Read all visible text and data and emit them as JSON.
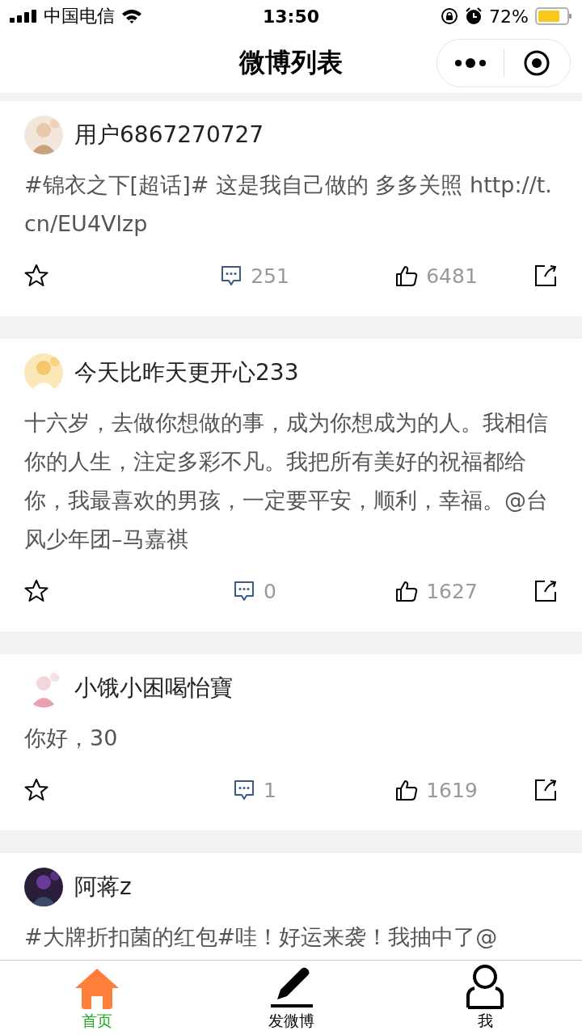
{
  "status_bar": {
    "carrier": "中国电信",
    "time": "13:50",
    "battery": "72%"
  },
  "nav": {
    "title": "微博列表"
  },
  "posts": [
    {
      "user": "用户6867270727",
      "text": "#锦衣之下[超话]# 这是我自己做的 多多关照 http://t.cn/EU4Vlzp",
      "comments": "251",
      "likes": "6481"
    },
    {
      "user": "今天比昨天更开心233",
      "text": "十六岁，去做你想做的事，成为你想成为的人。我相信你的人生，注定多彩不凡。我把所有美好的祝福都给你，我最喜欢的男孩，一定要平安，顺利，幸福。@台风少年团–马嘉祺",
      "comments": "0",
      "likes": "1627"
    },
    {
      "user": "小饿小困喝怡寶",
      "text": "你好，30",
      "comments": "1",
      "likes": "1619"
    },
    {
      "user": "阿蒋z",
      "text": "#大牌折扣菌的红包#哇！好运来袭！我抽中了@"
    }
  ],
  "tabs": [
    {
      "kind": "home",
      "label": "首页",
      "selected": true
    },
    {
      "kind": "compose",
      "label": "发微博",
      "selected": false
    },
    {
      "kind": "profile",
      "label": "我",
      "selected": false
    }
  ]
}
